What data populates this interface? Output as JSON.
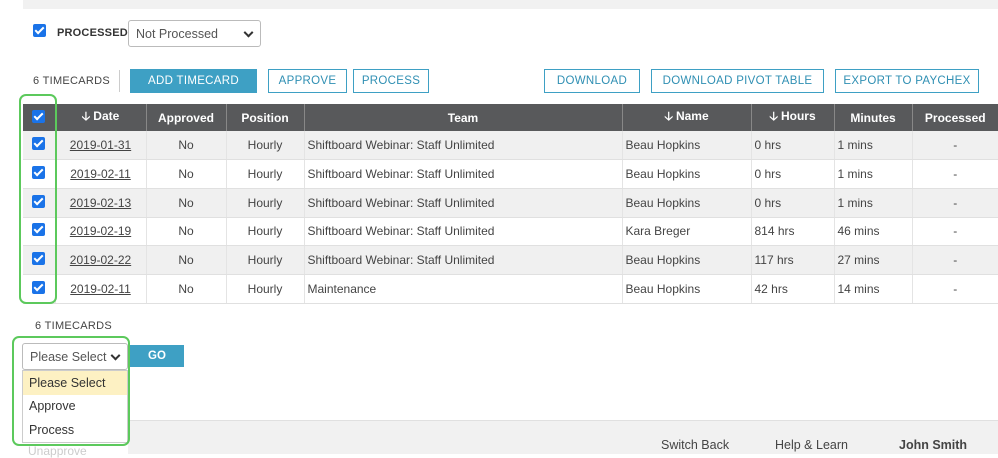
{
  "filter": {
    "checkbox_checked": true,
    "label": "PROCESSED",
    "select_value": "Not Processed"
  },
  "toolbar": {
    "count_label": "6 TIMECARDS",
    "add_timecard": "ADD TIMECARD",
    "approve": "APPROVE",
    "process": "PROCESS",
    "download": "DOWNLOAD",
    "download_pivot": "DOWNLOAD PIVOT TABLE",
    "export_paychex": "EXPORT TO PAYCHEX"
  },
  "table": {
    "headers": {
      "date": "Date",
      "approved": "Approved",
      "position": "Position",
      "team": "Team",
      "name": "Name",
      "hours": "Hours",
      "minutes": "Minutes",
      "processed": "Processed"
    },
    "rows": [
      {
        "date": "2019-01-31",
        "approved": "No",
        "position": "Hourly",
        "team": "Shiftboard Webinar: Staff Unlimited",
        "name": "Beau Hopkins",
        "hours": "0 hrs",
        "minutes": "1 mins",
        "processed": "-"
      },
      {
        "date": "2019-02-11",
        "approved": "No",
        "position": "Hourly",
        "team": "Shiftboard Webinar: Staff Unlimited",
        "name": "Beau Hopkins",
        "hours": "0 hrs",
        "minutes": "1 mins",
        "processed": "-"
      },
      {
        "date": "2019-02-13",
        "approved": "No",
        "position": "Hourly",
        "team": "Shiftboard Webinar: Staff Unlimited",
        "name": "Beau Hopkins",
        "hours": "0 hrs",
        "minutes": "1 mins",
        "processed": "-"
      },
      {
        "date": "2019-02-19",
        "approved": "No",
        "position": "Hourly",
        "team": "Shiftboard Webinar: Staff Unlimited",
        "name": "Kara Breger",
        "hours": "814 hrs",
        "minutes": "46 mins",
        "processed": "-"
      },
      {
        "date": "2019-02-22",
        "approved": "No",
        "position": "Hourly",
        "team": "Shiftboard Webinar: Staff Unlimited",
        "name": "Beau Hopkins",
        "hours": "117 hrs",
        "minutes": "27 mins",
        "processed": "-"
      },
      {
        "date": "2019-02-11",
        "approved": "No",
        "position": "Hourly",
        "team": "Maintenance",
        "name": "Beau Hopkins",
        "hours": "42 hrs",
        "minutes": "14 mins",
        "processed": "-"
      }
    ]
  },
  "bulk": {
    "count_label": "6 TIMECARDS",
    "select_value": "Please Select",
    "go": "GO",
    "options": [
      "Please Select",
      "Approve",
      "Process"
    ],
    "faded_option": "Unapprove"
  },
  "footer": {
    "switch_back": "Switch Back",
    "help": "Help & Learn",
    "user": "John Smith"
  },
  "colors": {
    "accent": "#3ea0c4",
    "header_bg": "#58595b",
    "highlight": "#5cc95c",
    "checkbox": "#1a73e8"
  }
}
